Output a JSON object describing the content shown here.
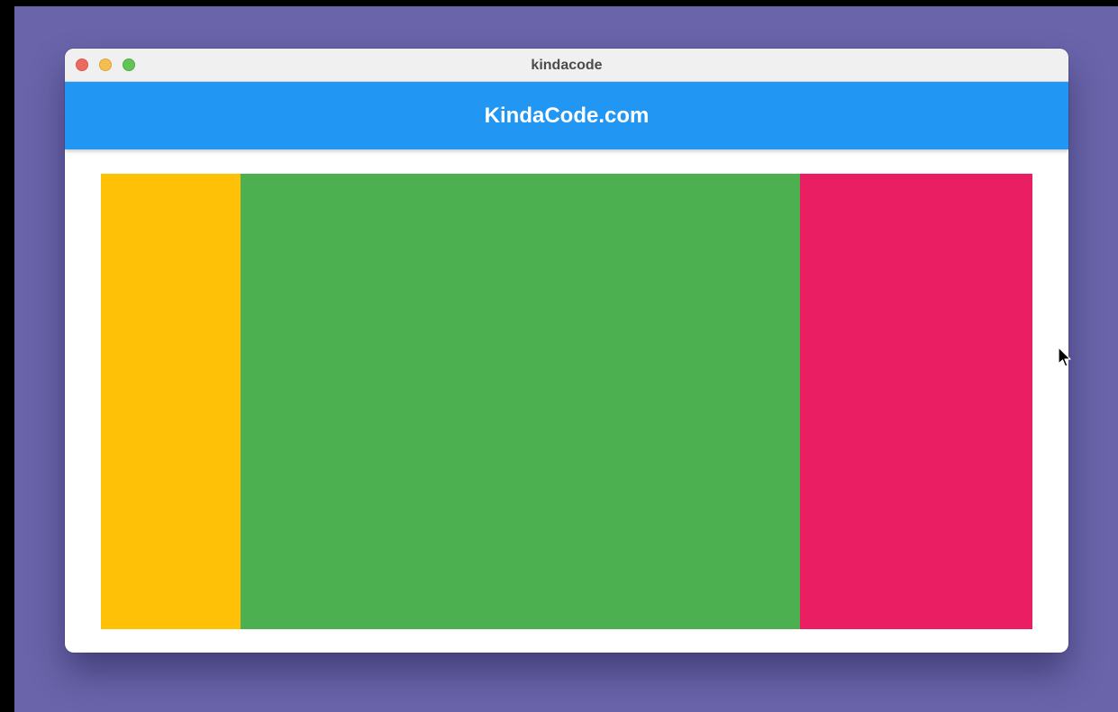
{
  "window": {
    "title": "kindacode"
  },
  "app_bar": {
    "title": "KindaCode.com",
    "color": "#2196f3"
  },
  "content": {
    "blocks": [
      {
        "name": "amber",
        "color": "#ffc107"
      },
      {
        "name": "green",
        "color": "#4caf50"
      },
      {
        "name": "pink",
        "color": "#e91e63"
      }
    ]
  },
  "desktop": {
    "background": "#6a65ab"
  },
  "icons": [
    "close-icon",
    "minimize-icon",
    "maximize-icon",
    "cursor-icon"
  ]
}
